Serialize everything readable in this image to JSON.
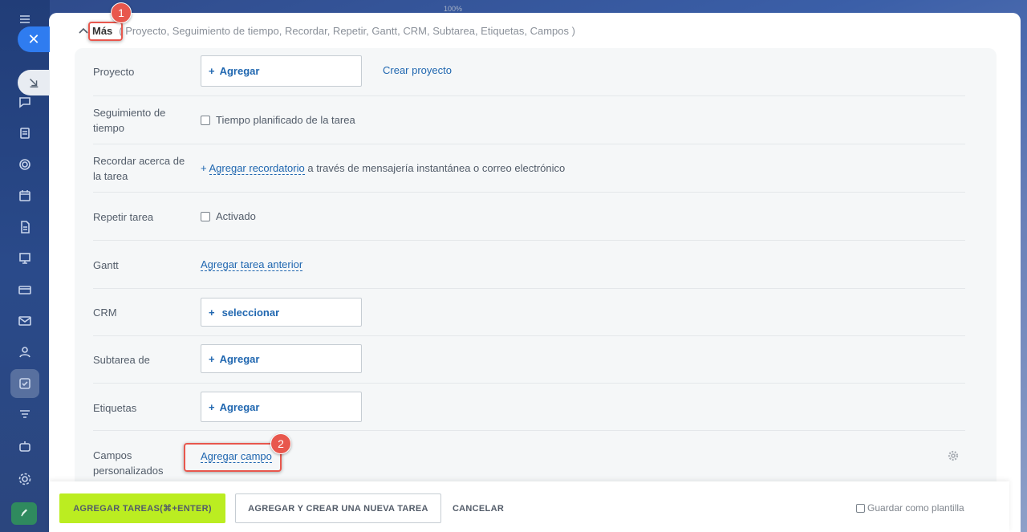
{
  "zoom": "100%",
  "more_section": {
    "label": "Más",
    "items_summary": "( Proyecto,  Seguimiento de tiempo,  Recordar,  Repetir,  Gantt,  CRM,  Subtarea,  Etiquetas,  Campos )"
  },
  "rows": {
    "project": {
      "label": "Proyecto",
      "add": "Agregar",
      "create_link": "Crear proyecto"
    },
    "time_tracking": {
      "label": "Seguimiento de tiempo",
      "checkbox": "Tiempo planificado de la tarea"
    },
    "reminder": {
      "label": "Recordar acerca de la tarea",
      "link": "Agregar recordatorio",
      "suffix": "a través de mensajería instantánea o correo electrónico"
    },
    "repeat": {
      "label": "Repetir tarea",
      "checkbox": "Activado"
    },
    "gantt": {
      "label": "Gantt",
      "link": "Agregar tarea anterior"
    },
    "crm": {
      "label": "CRM",
      "add": "seleccionar"
    },
    "subtask": {
      "label": "Subtarea de",
      "add": "Agregar"
    },
    "tags": {
      "label": "Etiquetas",
      "add": "Agregar"
    },
    "custom_fields": {
      "label": "Campos personalizados",
      "link": "Agregar campo"
    }
  },
  "plus_sign": "+",
  "badges": {
    "first": "1",
    "second": "2"
  },
  "footer": {
    "primary": "AGREGAR TAREAS(⌘+ENTER)",
    "secondary": "AGREGAR Y CREAR UNA NUEVA TAREA",
    "cancel": "CANCELAR",
    "save_template": "Guardar como plantilla"
  },
  "colors": {
    "link": "#2067b0",
    "primary_button": "#bbed21",
    "callout": "#e8574d"
  }
}
